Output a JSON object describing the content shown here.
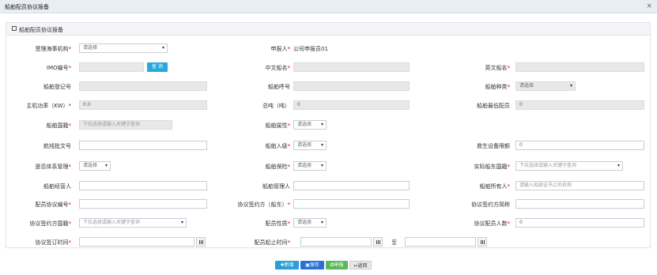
{
  "window": {
    "title": "船舶配员协议报备",
    "close_glyph": "×"
  },
  "panel": {
    "title": "船舶配员协议报备"
  },
  "required_mark": "*",
  "form": {
    "maritime_org": {
      "label": "受理海事机构",
      "value": "请选择"
    },
    "applicant": {
      "label": "申报人",
      "value": "公司申报员01"
    },
    "imo": {
      "label": "IMO编号",
      "value": "",
      "query_button": "查 询"
    },
    "cn_name": {
      "label": "中文船名",
      "value": ""
    },
    "en_name": {
      "label": "英文船名",
      "value": ""
    },
    "reg_no": {
      "label": "船舶登记号",
      "value": ""
    },
    "call_sign": {
      "label": "船舶呼号",
      "value": ""
    },
    "ship_type": {
      "label": "船舶种类",
      "value": "请选择"
    },
    "power": {
      "label": "主机功率（KW）",
      "value": "0.0"
    },
    "tonnage": {
      "label": "总吨（吨）",
      "value": "0"
    },
    "min_crew": {
      "label": "船舶最低配员",
      "value": "0"
    },
    "nationality": {
      "label": "船舶国籍",
      "placeholder": "下拉选择或输入关键字查询"
    },
    "attribute": {
      "label": "船舶属性",
      "value": "请选择"
    },
    "route_doc": {
      "label": "航线批文号",
      "value": ""
    },
    "in_port": {
      "label": "船舶入级",
      "value": "请选择"
    },
    "lifesaving": {
      "label": "救生设备限额",
      "value": "0"
    },
    "system_mgmt": {
      "label": "是否体系管理",
      "value": "请选择"
    },
    "insurance": {
      "label": "船舶保险",
      "value": "请选择"
    },
    "shipowner_country": {
      "label": "实际船东国籍",
      "placeholder": "下拉选择或输入关键字查询"
    },
    "operator": {
      "label": "船舶经营人",
      "value": ""
    },
    "manager": {
      "label": "船舶管理人",
      "value": ""
    },
    "owner": {
      "label": "船舶所有人",
      "placeholder": "请输入船舶证书上的名称"
    },
    "agreement_no": {
      "label": "配员协议编号",
      "value": ""
    },
    "party_a": {
      "label": "协议签约方（船东）",
      "value": ""
    },
    "party_b": {
      "label": "协议签约方简称",
      "value": ""
    },
    "party_country": {
      "label": "协议签约方国籍",
      "placeholder": "下拉选择或输入关键字查询"
    },
    "crew_nature": {
      "label": "配员性质",
      "value": "请选择"
    },
    "crew_count": {
      "label": "协议配员人数",
      "value": "0"
    },
    "sign_time": {
      "label": "协议签订时间",
      "value": ""
    },
    "period": {
      "label": "配员起止时间",
      "start": "",
      "to": "至",
      "end": ""
    }
  },
  "actions": [
    {
      "label": "新增",
      "glyph": "✚",
      "color": "#2a9fd6"
    },
    {
      "label": "保存",
      "glyph": "▣",
      "color": "#2a6fd6"
    },
    {
      "label": "申报",
      "glyph": "✪",
      "color": "#5cb85c"
    },
    {
      "label": "返回",
      "glyph": "↩",
      "color": "#e8e8e8"
    }
  ]
}
